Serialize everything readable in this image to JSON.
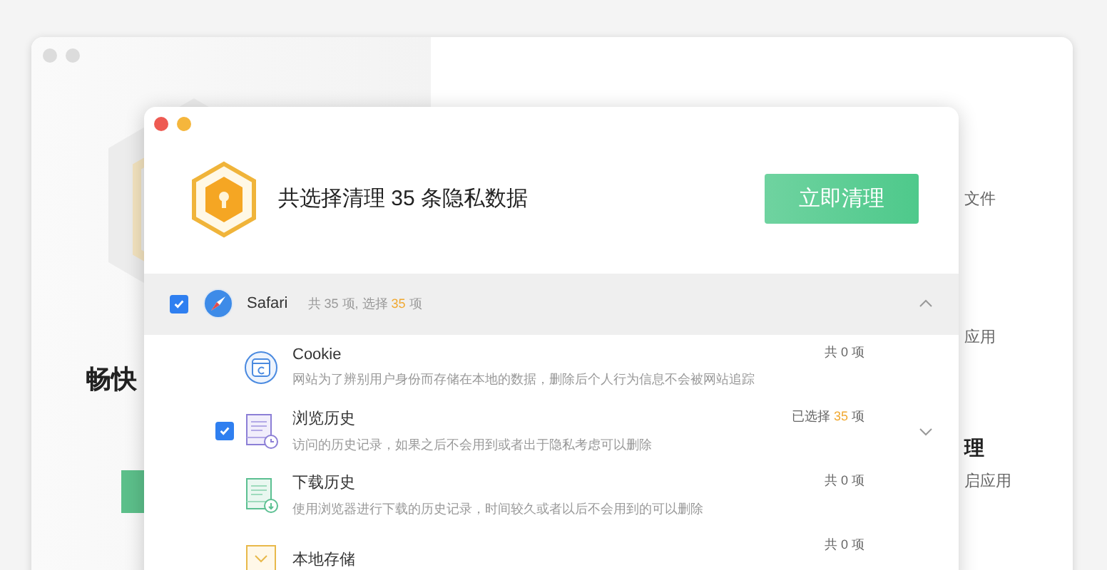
{
  "background_window": {
    "hero_title": "畅快",
    "fragments": [
      {
        "text": "文件",
        "kind": "text"
      },
      {
        "text": "应用",
        "kind": "text"
      },
      {
        "text": "理",
        "kind": "heading"
      },
      {
        "text": "启应用",
        "kind": "text"
      }
    ]
  },
  "dialog": {
    "summary": "共选择清理 35 条隐私数据",
    "clean_button": "立即清理",
    "browser": {
      "name": "Safari",
      "checked": true,
      "expanded": true,
      "count_prefix": "共 35 项, 选择 ",
      "count_highlight": "35",
      "count_suffix": " 项"
    },
    "items": [
      {
        "kind": "cookie",
        "title": "Cookie",
        "description": "网站为了辨别用户身份而存储在本地的数据，删除后个人行为信息不会被网站追踪",
        "checked": false,
        "hovered": false,
        "count_prefix": "共 0 项"
      },
      {
        "kind": "history",
        "title": "浏览历史",
        "description": "访问的历史记录，如果之后不会用到或者出于隐私考虑可以删除",
        "checked": true,
        "hovered": true,
        "count_prefix": "已选择 ",
        "count_highlight": "35",
        "count_suffix": " 项"
      },
      {
        "kind": "download",
        "title": "下载历史",
        "description": "使用浏览器进行下载的历史记录，时间较久或者以后不会用到的可以删除",
        "checked": false,
        "hovered": false,
        "count_prefix": "共 0 项"
      },
      {
        "kind": "storage",
        "title": "本地存储",
        "checked": false,
        "hovered": false,
        "count_prefix": "共 0 项"
      }
    ]
  }
}
